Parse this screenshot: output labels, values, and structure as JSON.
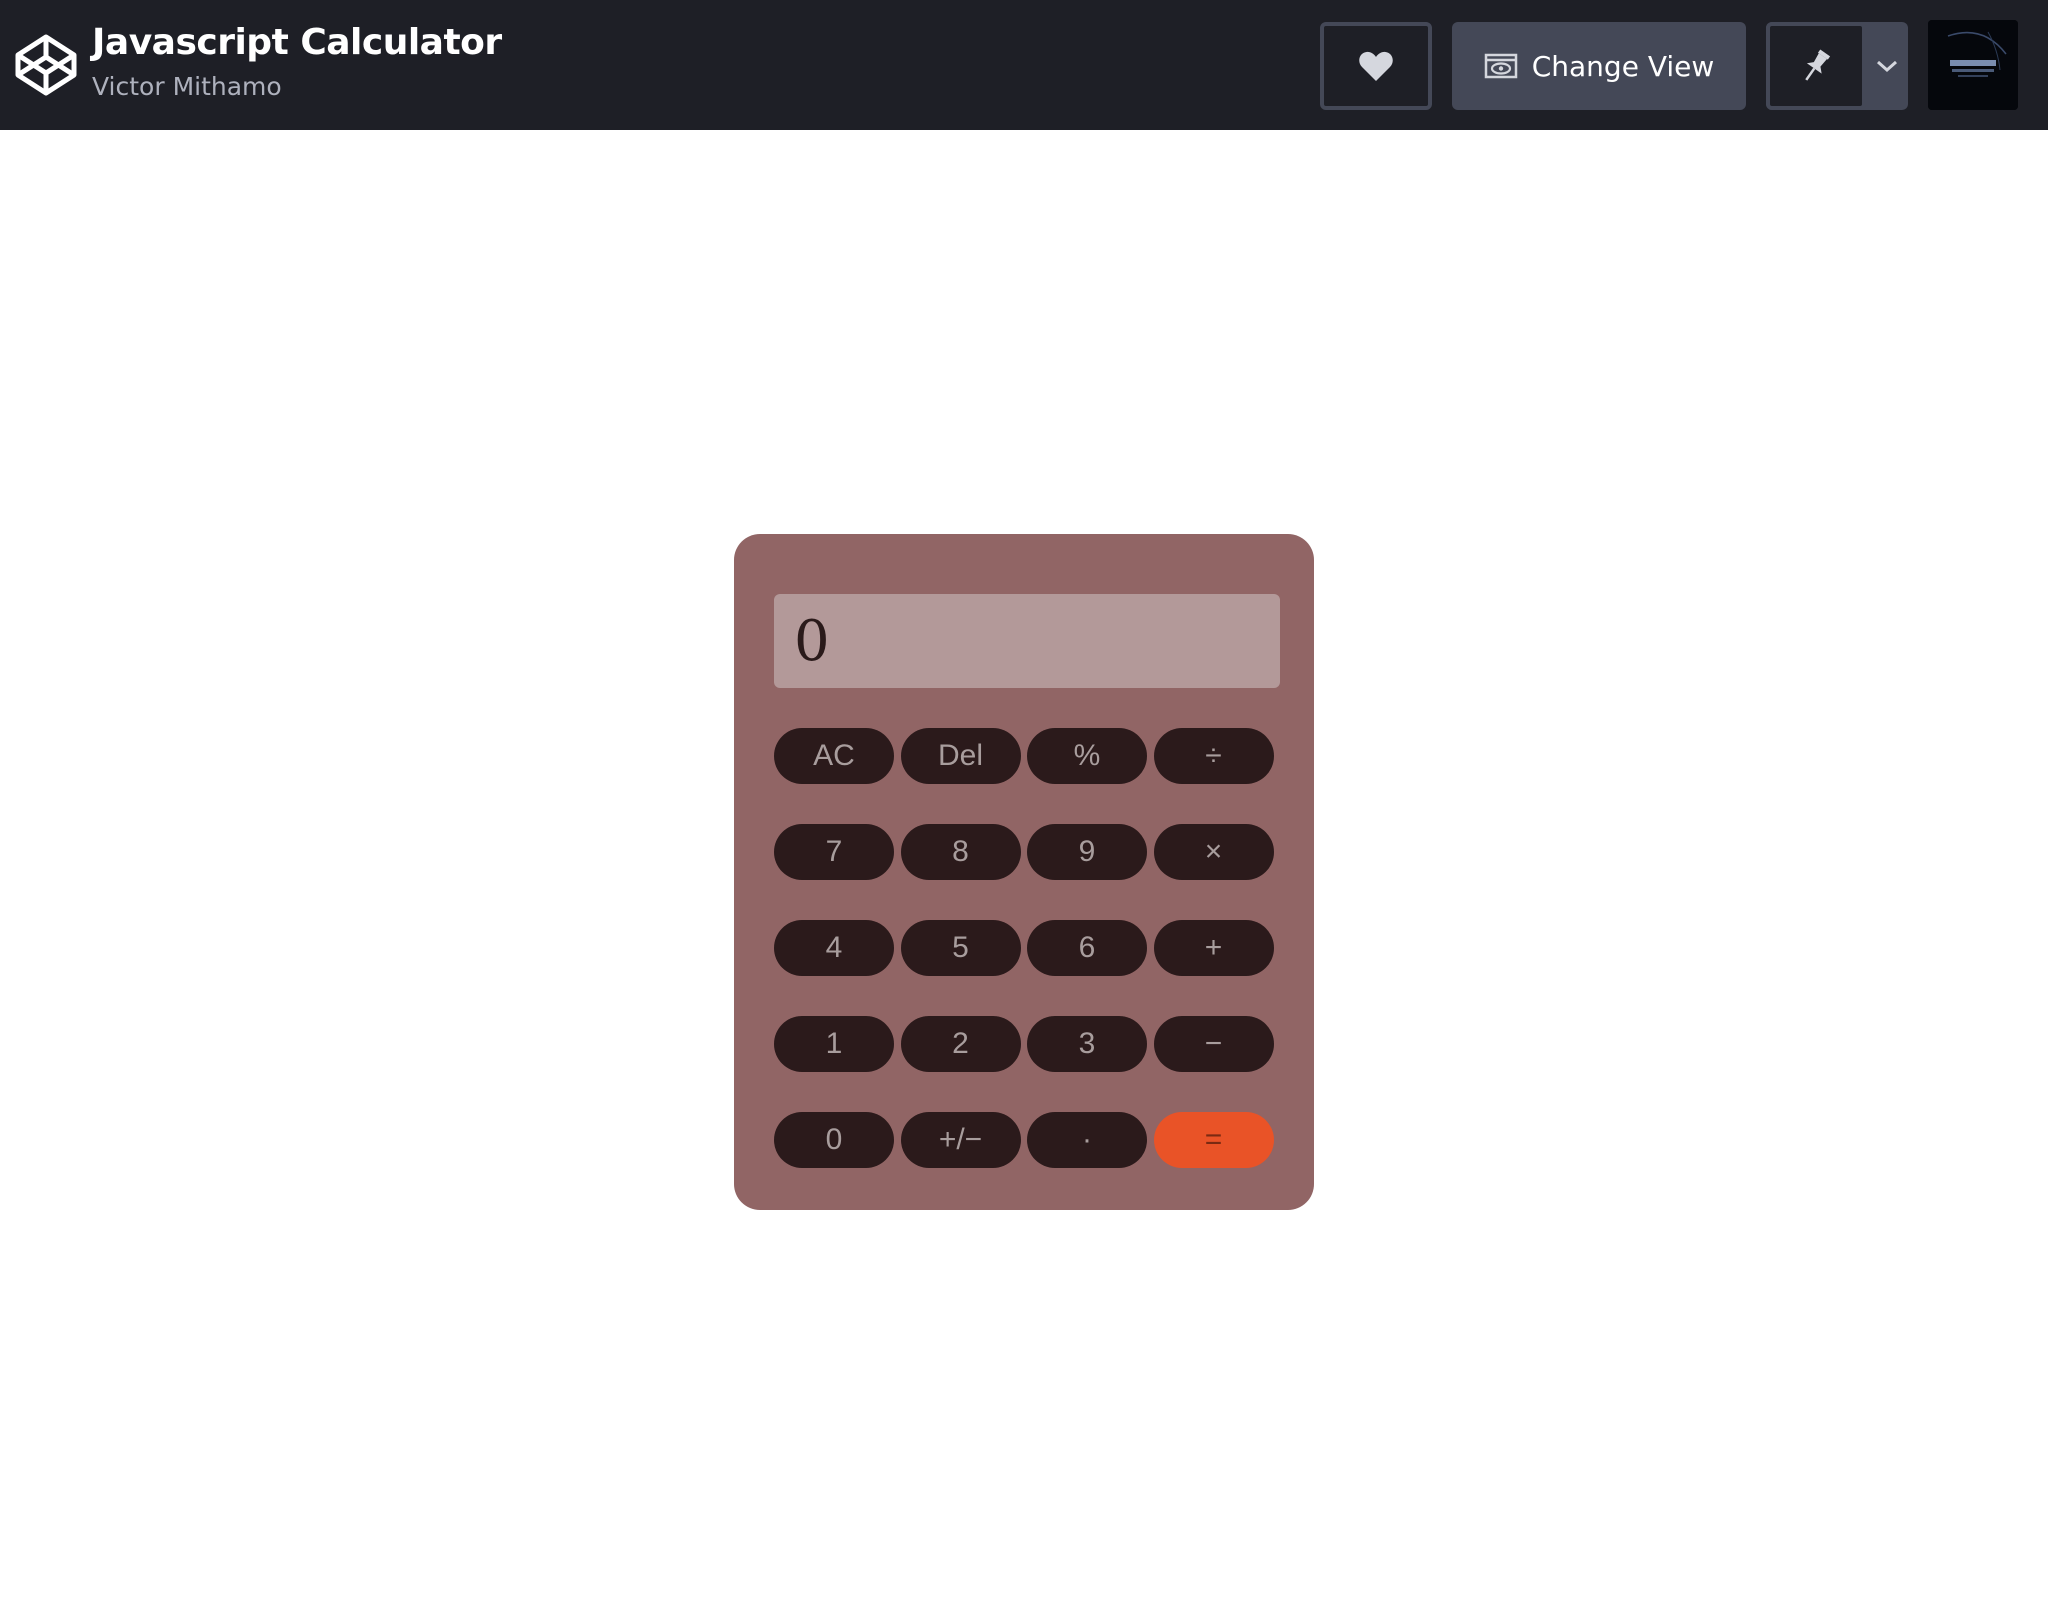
{
  "header": {
    "pen_title": "Javascript Calculator",
    "author": "Victor Mithamo",
    "change_view_label": "Change View",
    "icons": {
      "logo": "codepen-logo-icon",
      "heart": "heart-icon",
      "view": "eye-window-icon",
      "pin": "pin-icon",
      "dropdown": "chevron-down-icon"
    }
  },
  "calculator": {
    "display_value": "0",
    "keys": [
      {
        "label": "AC",
        "type": "function"
      },
      {
        "label": "Del",
        "type": "function"
      },
      {
        "label": "%",
        "type": "function"
      },
      {
        "label": "÷",
        "type": "operator"
      },
      {
        "label": "7",
        "type": "digit"
      },
      {
        "label": "8",
        "type": "digit"
      },
      {
        "label": "9",
        "type": "digit"
      },
      {
        "label": "×",
        "type": "operator"
      },
      {
        "label": "4",
        "type": "digit"
      },
      {
        "label": "5",
        "type": "digit"
      },
      {
        "label": "6",
        "type": "digit"
      },
      {
        "label": "+",
        "type": "operator"
      },
      {
        "label": "1",
        "type": "digit"
      },
      {
        "label": "2",
        "type": "digit"
      },
      {
        "label": "3",
        "type": "digit"
      },
      {
        "label": "−",
        "type": "operator"
      },
      {
        "label": "0",
        "type": "digit"
      },
      {
        "label": "+/−",
        "type": "function"
      },
      {
        "label": "·",
        "type": "digit"
      },
      {
        "label": "=",
        "type": "equals"
      }
    ]
  },
  "colors": {
    "header_bg": "#1e1f26",
    "button_bg": "#444857",
    "calculator_body": "#916565",
    "display_bg": "#b39999",
    "key_bg": "#2b1a1b",
    "equals_bg": "#e95327"
  }
}
